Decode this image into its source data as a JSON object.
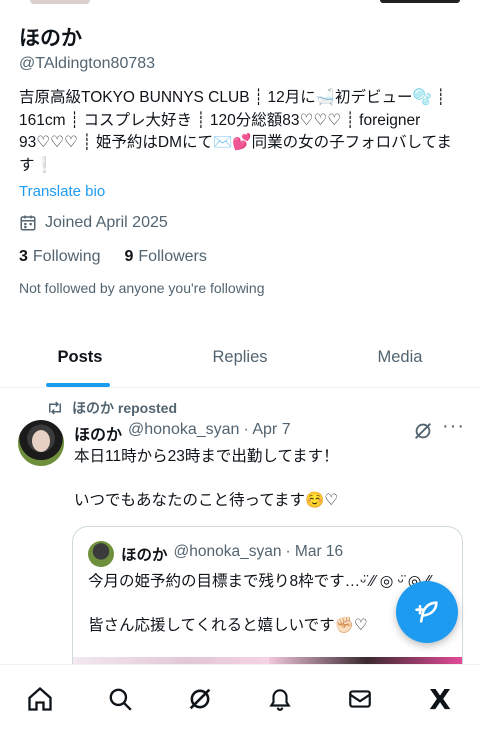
{
  "profile": {
    "display_name": "ほのか",
    "handle": "@TAldington80783",
    "bio": "吉原高級TOKYO BUNNYS CLUB ┊ 12月に🛁初デビュー🫧 ┊ 161cm ┊ コスプレ大好き ┊ 120分総額83♡♡♡ ┊ foreigner 93♡♡♡ ┊ 姫予約はDMにて✉️💕同業の女の子フォロバしてます❕",
    "translate_label": "Translate bio",
    "joined": "Joined April 2025",
    "following_count": "3",
    "following_label": "Following",
    "followers_count": "9",
    "followers_label": "Followers",
    "not_followed_text": "Not followed by anyone you're following"
  },
  "tabs": [
    {
      "label": "Posts",
      "active": true
    },
    {
      "label": "Replies",
      "active": false
    },
    {
      "label": "Media",
      "active": false
    }
  ],
  "post": {
    "repost_label": "ほのか reposted",
    "author_name": "ほのか",
    "author_handle": "@honoka_syan",
    "date": "· Apr 7",
    "more_label": "···",
    "text_line1": "本日11時から23時まで出勤してます！",
    "text_line2": "いつでもあなたのこと待ってます☺️♡",
    "quote": {
      "author_name": "ほのか",
      "author_handle": "@honoka_syan",
      "date": "· Mar 16",
      "text_line1": "今月の姫予約の目標まで残り8枠です…ᵕ̈ ⁄⁄ ◎ ᵕ̈ ◎ ⁄⁄",
      "text_line2": "皆さん応援してくれると嬉しいです✊🏻♡"
    }
  },
  "nav": {
    "x_logo": "X"
  },
  "colors": {
    "accent": "#1d9bf0",
    "text_primary": "#0f1419",
    "text_secondary": "#536471"
  }
}
